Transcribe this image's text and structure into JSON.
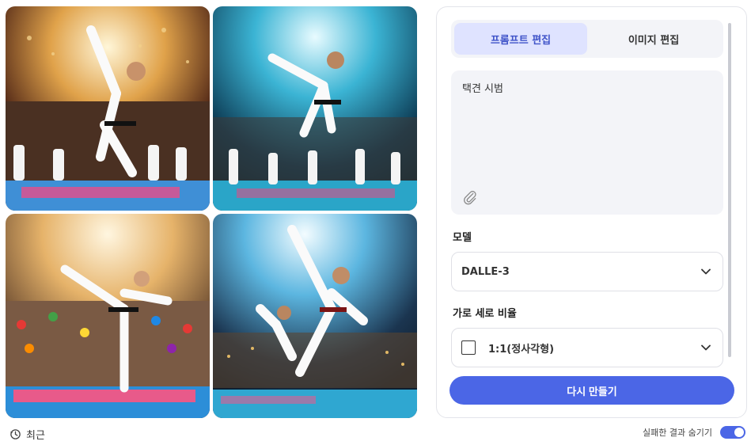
{
  "images": [
    {
      "alt": "taekwondo-image-1"
    },
    {
      "alt": "taekwondo-image-2"
    },
    {
      "alt": "taekwondo-image-3"
    },
    {
      "alt": "taekwondo-image-4"
    }
  ],
  "recent": {
    "label": "최근",
    "icon": "history-icon"
  },
  "tabs": [
    {
      "label": "프롬프트 편집",
      "active": true
    },
    {
      "label": "이미지 편집",
      "active": false
    }
  ],
  "prompt": {
    "text": "택견 시범",
    "icon": "paperclip-icon"
  },
  "model": {
    "label": "모델",
    "value": "DALLE-3"
  },
  "aspect": {
    "label": "가로 세로 비율",
    "value": "1:1(정사각형)"
  },
  "regenerate": {
    "label": "다시 만들기"
  },
  "hide_failed": {
    "label": "실패한 결과 숨기기",
    "on": true
  },
  "colors": {
    "accent": "#4b66e6",
    "tab_active_bg": "#dfe3ff",
    "tab_active_text": "#4054c9"
  }
}
